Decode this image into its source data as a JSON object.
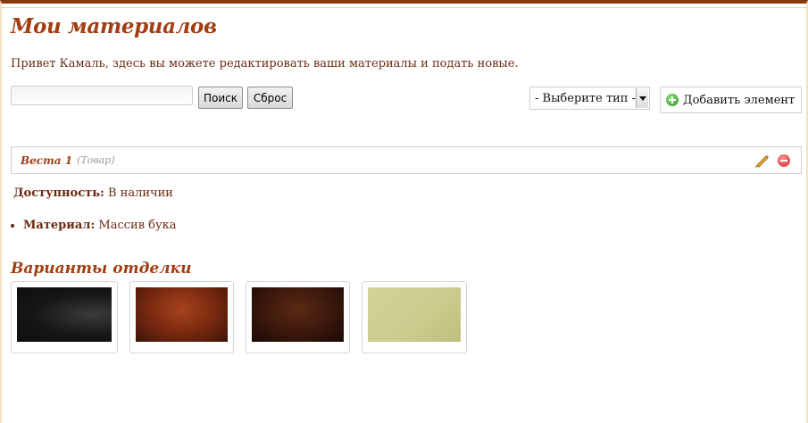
{
  "page": {
    "title": "Мои материалов",
    "intro": "Привет Камаль, здесь вы можете редактировать ваши материалы и подать новые."
  },
  "toolbar": {
    "search_value": "",
    "search_button": "Поиск",
    "reset_button": "Сброс",
    "type_select": "- Выберите тип -",
    "add_button": "Добавить элемент"
  },
  "item": {
    "name": "Веста 1",
    "type": "(Товар)",
    "availability_label": "Доступность:",
    "availability_value": "В наличии",
    "material_label": "Материал:",
    "material_value": "Массив бука"
  },
  "finishes": {
    "title": "Варианты отделки",
    "swatches": [
      {
        "color": "#151715"
      },
      {
        "color": "#7a2a10"
      },
      {
        "color": "#3a170c"
      },
      {
        "color": "#c9cc8c"
      }
    ]
  },
  "colors": {
    "accent": "#a13f13",
    "text": "#6b2a12",
    "top_border": "#8b3a0e"
  }
}
